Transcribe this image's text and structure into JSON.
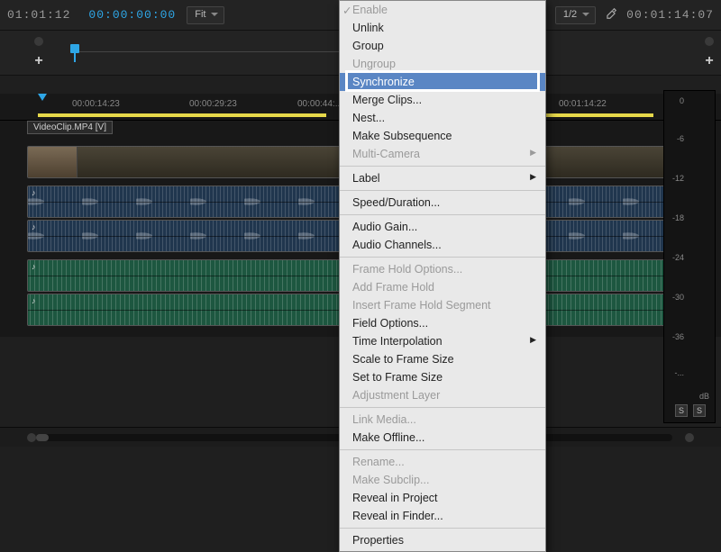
{
  "topbar": {
    "timecode_left": "01:01:12",
    "timecode_blue": "00:00:00:00",
    "fit_label": "Fit",
    "half_label": "1/2",
    "timecode_right": "00:01:14:07"
  },
  "ruler": {
    "ticks": [
      "00:00:14:23",
      "00:00:29:23",
      "00:00:44:...",
      "00:01:14:22"
    ]
  },
  "clip": {
    "label": "VideoClip.MP4 [V]"
  },
  "meter": {
    "labels": [
      "0",
      "-6",
      "-12",
      "-18",
      "-24",
      "-30",
      "-36",
      "-..."
    ],
    "unit": "dB",
    "solo": "S"
  },
  "menu": {
    "items": [
      {
        "label": "Enable",
        "disabled": true,
        "check": true
      },
      {
        "label": "Unlink"
      },
      {
        "label": "Group"
      },
      {
        "label": "Ungroup",
        "disabled": true
      },
      {
        "label": "Synchronize",
        "highlight": true
      },
      {
        "label": "Merge Clips..."
      },
      {
        "label": "Nest..."
      },
      {
        "label": "Make Subsequence"
      },
      {
        "label": "Multi-Camera",
        "disabled": true,
        "sub": true
      },
      {
        "sep": true
      },
      {
        "label": "Label",
        "sub": true
      },
      {
        "sep": true
      },
      {
        "label": "Speed/Duration..."
      },
      {
        "sep": true
      },
      {
        "label": "Audio Gain..."
      },
      {
        "label": "Audio Channels..."
      },
      {
        "sep": true
      },
      {
        "label": "Frame Hold Options...",
        "disabled": true
      },
      {
        "label": "Add Frame Hold",
        "disabled": true
      },
      {
        "label": "Insert Frame Hold Segment",
        "disabled": true
      },
      {
        "label": "Field Options..."
      },
      {
        "label": "Time Interpolation",
        "sub": true
      },
      {
        "label": "Scale to Frame Size"
      },
      {
        "label": "Set to Frame Size"
      },
      {
        "label": "Adjustment Layer",
        "disabled": true
      },
      {
        "sep": true
      },
      {
        "label": "Link Media...",
        "disabled": true
      },
      {
        "label": "Make Offline..."
      },
      {
        "sep": true
      },
      {
        "label": "Rename...",
        "disabled": true
      },
      {
        "label": "Make Subclip...",
        "disabled": true
      },
      {
        "label": "Reveal in Project"
      },
      {
        "label": "Reveal in Finder..."
      },
      {
        "sep": true
      },
      {
        "label": "Properties"
      }
    ]
  }
}
